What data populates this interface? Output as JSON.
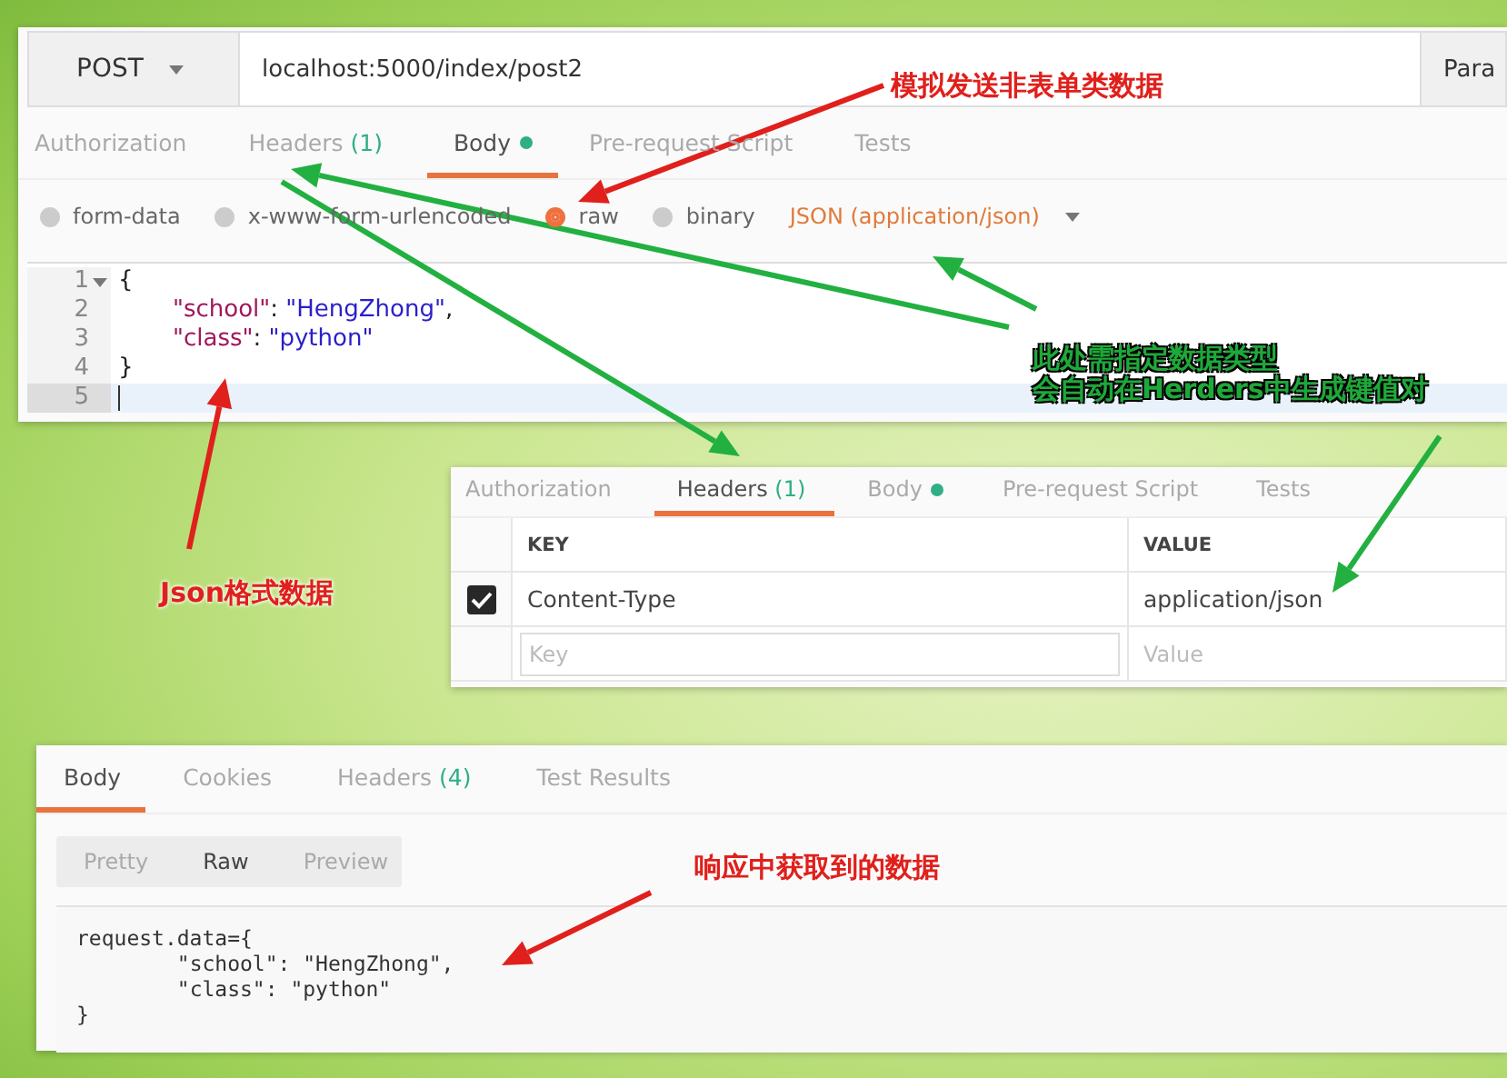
{
  "request_panel": {
    "method": "POST",
    "url": "localhost:5000/index/post2",
    "params_button": "Para",
    "tabs": [
      {
        "label": "Authorization",
        "selected": false
      },
      {
        "label": "Headers",
        "count": "(1)",
        "selected": false
      },
      {
        "label": "Body",
        "dot": true,
        "selected": true
      },
      {
        "label": "Pre-request Script",
        "selected": false
      },
      {
        "label": "Tests",
        "selected": false
      }
    ],
    "body_types": [
      {
        "label": "form-data",
        "selected": false
      },
      {
        "label": "x-www-form-urlencoded",
        "selected": false
      },
      {
        "label": "raw",
        "selected": true
      },
      {
        "label": "binary",
        "selected": false
      }
    ],
    "content_type": "JSON (application/json)",
    "code_lines": [
      {
        "number": "1",
        "current": false,
        "foldable": true,
        "tokens": [
          {
            "kind": "punct",
            "text": "{"
          }
        ]
      },
      {
        "number": "2",
        "current": false,
        "foldable": false,
        "indented": true,
        "tokens": [
          {
            "kind": "key",
            "text": "\"school\""
          },
          {
            "kind": "punct",
            "text": ": "
          },
          {
            "kind": "string",
            "text": "\"HengZhong\""
          },
          {
            "kind": "punct",
            "text": ","
          }
        ]
      },
      {
        "number": "3",
        "current": false,
        "foldable": false,
        "indented": true,
        "tokens": [
          {
            "kind": "key",
            "text": "\"class\""
          },
          {
            "kind": "punct",
            "text": ": "
          },
          {
            "kind": "string",
            "text": "\"python\""
          }
        ]
      },
      {
        "number": "4",
        "current": false,
        "foldable": false,
        "tokens": [
          {
            "kind": "punct",
            "text": "}"
          }
        ]
      },
      {
        "number": "5",
        "current": true,
        "foldable": false
      }
    ]
  },
  "headers_panel": {
    "tabs": [
      {
        "label": "Authorization",
        "selected": false
      },
      {
        "label": "Headers",
        "count": "(1)",
        "selected": true
      },
      {
        "label": "Body",
        "dot": true,
        "selected": false
      },
      {
        "label": "Pre-request Script",
        "selected": false
      },
      {
        "label": "Tests",
        "selected": false
      }
    ],
    "columns": [
      "KEY",
      "VALUE"
    ],
    "rows": [
      {
        "checked": true,
        "key": "Content-Type",
        "value": "application/json"
      }
    ],
    "new_row": {
      "key_placeholder": "Key",
      "value_placeholder": "Value"
    }
  },
  "response_panel": {
    "tabs": [
      {
        "label": "Body",
        "selected": true
      },
      {
        "label": "Cookies",
        "selected": false
      },
      {
        "label": "Headers",
        "count": "(4)",
        "selected": false
      },
      {
        "label": "Test Results",
        "selected": false
      }
    ],
    "view_modes": [
      {
        "label": "Pretty",
        "selected": false
      },
      {
        "label": "Raw",
        "selected": true
      },
      {
        "label": "Preview",
        "selected": false
      }
    ],
    "body": "request.data={\n\t\"school\": \"HengZhong\",\n\t\"class\": \"python\"\n}"
  },
  "annotations": [
    {
      "text": "模拟发送非表单类数据",
      "color": "#e0201c"
    },
    {
      "text": "此处需指定数据类型",
      "color": "#1fa83a"
    },
    {
      "text": "会自动在Herders中生成键值对",
      "color": "#1fa83a"
    },
    {
      "text": "Json格式数据",
      "color": "#e0201c"
    },
    {
      "text": "响应中获取到的数据",
      "color": "#e0201c"
    }
  ]
}
